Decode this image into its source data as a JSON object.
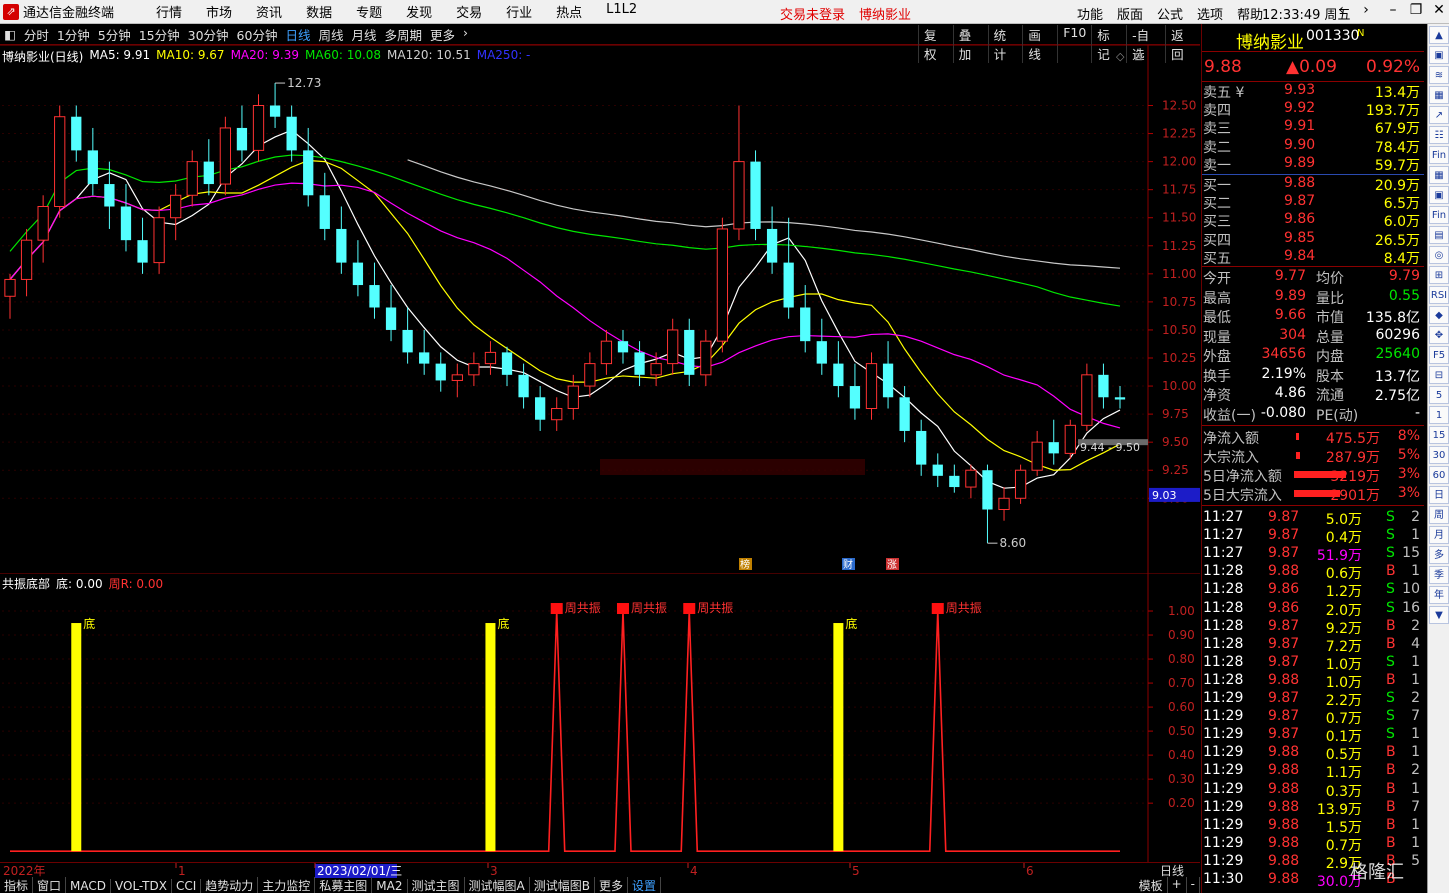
{
  "titlebar": {
    "app_title": "通达信金融终端",
    "menus": [
      "行情",
      "市场",
      "资讯",
      "数据",
      "专题",
      "发现",
      "交易",
      "行业",
      "热点",
      "L1L2"
    ],
    "login_status": "交易未登录",
    "stock_name": "博纳影业",
    "right_menus": [
      "功能",
      "版面",
      "公式",
      "选项",
      "帮助"
    ],
    "clock": "12:33:49",
    "weekday": "周五"
  },
  "periods": [
    "分时",
    "1分钟",
    "5分钟",
    "15分钟",
    "30分钟",
    "60分钟",
    "日线",
    "周线",
    "月线",
    "多周期",
    "更多"
  ],
  "active_period": "日线",
  "toolbuttons": [
    "复权",
    "叠加",
    "统计",
    "画线",
    "F10",
    "标记",
    "-自选",
    "返回"
  ],
  "main_info": {
    "title": "博纳影业(日线)",
    "ma5": "MA5: 9.91",
    "ma10": "MA10: 9.67",
    "ma20": "MA20: 9.39",
    "ma60": "MA60: 10.08",
    "ma120": "MA120: 10.51",
    "ma250": "MA250: -"
  },
  "sub_info": {
    "title": "共振底部",
    "bottom": "底: 0.00",
    "weekr": "周R: 0.00"
  },
  "chart_data": [
    {
      "type": "candlestick",
      "axis": "price",
      "yticks": [
        "12.50",
        "12.25",
        "12.00",
        "11.75",
        "11.50",
        "11.25",
        "11.00",
        "10.75",
        "10.50",
        "10.25",
        "10.00",
        "9.75",
        "9.50",
        "9.25",
        "9.00"
      ],
      "ylim": [
        8.45,
        12.95
      ],
      "annotations": {
        "high": "12.73",
        "low": "8.60",
        "last_label": "9.44 - 9.50",
        "current_price": "9.03",
        "markers": [
          "榜",
          "财",
          "涨"
        ]
      },
      "candles": [
        [
          10.8,
          11.0,
          10.6,
          10.95
        ],
        [
          10.95,
          11.4,
          10.8,
          11.3
        ],
        [
          11.3,
          11.7,
          11.1,
          11.6
        ],
        [
          11.6,
          12.5,
          11.5,
          12.4
        ],
        [
          12.4,
          12.5,
          12.0,
          12.1
        ],
        [
          12.1,
          12.3,
          11.7,
          11.8
        ],
        [
          11.8,
          12.0,
          11.4,
          11.6
        ],
        [
          11.6,
          11.8,
          11.2,
          11.3
        ],
        [
          11.3,
          11.5,
          11.0,
          11.1
        ],
        [
          11.1,
          11.6,
          11.0,
          11.5
        ],
        [
          11.5,
          11.8,
          11.3,
          11.7
        ],
        [
          11.7,
          12.1,
          11.6,
          12.0
        ],
        [
          12.0,
          12.2,
          11.7,
          11.8
        ],
        [
          11.8,
          12.4,
          11.7,
          12.3
        ],
        [
          12.3,
          12.5,
          12.0,
          12.1
        ],
        [
          12.1,
          12.6,
          12.0,
          12.5
        ],
        [
          12.5,
          12.7,
          12.3,
          12.4
        ],
        [
          12.4,
          12.5,
          12.0,
          12.1
        ],
        [
          12.1,
          12.3,
          11.6,
          11.7
        ],
        [
          11.7,
          11.9,
          11.3,
          11.4
        ],
        [
          11.4,
          11.6,
          11.0,
          11.1
        ],
        [
          11.1,
          11.3,
          10.8,
          10.9
        ],
        [
          10.9,
          11.1,
          10.6,
          10.7
        ],
        [
          10.7,
          10.9,
          10.4,
          10.5
        ],
        [
          10.5,
          10.7,
          10.2,
          10.3
        ],
        [
          10.3,
          10.5,
          10.1,
          10.2
        ],
        [
          10.2,
          10.3,
          9.95,
          10.05
        ],
        [
          10.05,
          10.2,
          9.9,
          10.1
        ],
        [
          10.1,
          10.3,
          10.0,
          10.2
        ],
        [
          10.2,
          10.4,
          10.1,
          10.3
        ],
        [
          10.3,
          10.35,
          10.0,
          10.1
        ],
        [
          10.1,
          10.2,
          9.8,
          9.9
        ],
        [
          9.9,
          10.0,
          9.6,
          9.7
        ],
        [
          9.7,
          9.9,
          9.6,
          9.8
        ],
        [
          9.8,
          10.1,
          9.7,
          10.0
        ],
        [
          10.0,
          10.3,
          9.9,
          10.2
        ],
        [
          10.2,
          10.5,
          10.1,
          10.4
        ],
        [
          10.4,
          10.5,
          10.2,
          10.3
        ],
        [
          10.3,
          10.4,
          10.0,
          10.1
        ],
        [
          10.1,
          10.3,
          10.0,
          10.2
        ],
        [
          10.2,
          10.6,
          10.1,
          10.5
        ],
        [
          10.5,
          10.6,
          10.0,
          10.1
        ],
        [
          10.1,
          10.5,
          10.0,
          10.4
        ],
        [
          10.4,
          11.5,
          10.3,
          11.4
        ],
        [
          11.4,
          12.5,
          11.3,
          12.0
        ],
        [
          12.0,
          12.1,
          11.3,
          11.4
        ],
        [
          11.4,
          11.6,
          11.0,
          11.1
        ],
        [
          11.1,
          11.5,
          10.6,
          10.7
        ],
        [
          10.7,
          10.9,
          10.3,
          10.4
        ],
        [
          10.4,
          10.6,
          10.1,
          10.2
        ],
        [
          10.2,
          10.4,
          9.9,
          10.0
        ],
        [
          10.0,
          10.2,
          9.7,
          9.8
        ],
        [
          9.8,
          10.3,
          9.7,
          10.2
        ],
        [
          10.2,
          10.4,
          9.8,
          9.9
        ],
        [
          9.9,
          10.0,
          9.5,
          9.6
        ],
        [
          9.6,
          9.7,
          9.2,
          9.3
        ],
        [
          9.3,
          9.4,
          9.1,
          9.2
        ],
        [
          9.2,
          9.3,
          9.05,
          9.1
        ],
        [
          9.1,
          9.3,
          9.0,
          9.25
        ],
        [
          9.25,
          9.3,
          8.6,
          8.9
        ],
        [
          8.9,
          9.1,
          8.8,
          9.0
        ],
        [
          9.0,
          9.3,
          8.95,
          9.25
        ],
        [
          9.25,
          9.6,
          9.2,
          9.5
        ],
        [
          9.5,
          9.7,
          9.3,
          9.4
        ],
        [
          9.4,
          9.7,
          9.35,
          9.65
        ],
        [
          9.65,
          10.2,
          9.6,
          10.1
        ],
        [
          10.1,
          10.2,
          9.8,
          9.9
        ],
        [
          9.9,
          10.0,
          9.8,
          9.88
        ]
      ]
    },
    {
      "type": "indicator",
      "axis": "value",
      "yticks": [
        "1.00",
        "0.90",
        "0.80",
        "0.70",
        "0.60",
        "0.50",
        "0.40",
        "0.30",
        "0.20"
      ],
      "ylim": [
        -0.02,
        1.1
      ],
      "bottom_bars": [
        {
          "index": 4,
          "label": "底"
        },
        {
          "index": 29,
          "label": "底"
        },
        {
          "index": 50,
          "label": "底"
        }
      ],
      "week_spikes": [
        {
          "index": 33,
          "label": "周共振"
        },
        {
          "index": 37,
          "label": "周共振"
        },
        {
          "index": 41,
          "label": "周共振"
        },
        {
          "index": 56,
          "label": "周共振"
        }
      ]
    }
  ],
  "dates": {
    "year": "2022年",
    "ticks": [
      "1",
      "2023/02/01/三",
      "3",
      "4",
      "5",
      "6"
    ],
    "period_label": "日线"
  },
  "bottom_tabs": [
    "指标",
    "窗口",
    "MACD",
    "VOL-TDX",
    "CCI",
    "趋势动力",
    "主力监控",
    "私募主图",
    "MA2",
    "测试主图",
    "测试幅图A",
    "测试幅图B",
    "更多",
    "设置"
  ],
  "bottom_right": [
    "模板",
    "+",
    "-"
  ],
  "quote": {
    "name": "博纳影业",
    "code": "001330",
    "badge": "N",
    "price": "9.88",
    "change": "▲0.09",
    "pct": "0.92%",
    "sells": [
      {
        "label": "卖五",
        "price": "9.93",
        "vol": "13.4万"
      },
      {
        "label": "卖四",
        "price": "9.92",
        "vol": "193.7万"
      },
      {
        "label": "卖三",
        "price": "9.91",
        "vol": "67.9万"
      },
      {
        "label": "卖二",
        "price": "9.90",
        "vol": "78.4万"
      },
      {
        "label": "卖一",
        "price": "9.89",
        "vol": "59.7万"
      }
    ],
    "buys": [
      {
        "label": "买一",
        "price": "9.88",
        "vol": "20.9万"
      },
      {
        "label": "买二",
        "price": "9.87",
        "vol": "6.5万"
      },
      {
        "label": "买三",
        "price": "9.86",
        "vol": "6.0万"
      },
      {
        "label": "买四",
        "price": "9.85",
        "vol": "26.5万"
      },
      {
        "label": "买五",
        "price": "9.84",
        "vol": "8.4万"
      }
    ],
    "stats": [
      [
        "今开",
        "9.77",
        "均价",
        "9.79"
      ],
      [
        "最高",
        "9.89",
        "量比",
        "0.55"
      ],
      [
        "最低",
        "9.66",
        "市值",
        "135.8亿"
      ],
      [
        "现量",
        "304",
        "总量",
        "60296"
      ],
      [
        "外盘",
        "34656",
        "内盘",
        "25640"
      ],
      [
        "换手",
        "2.19%",
        "股本",
        "13.7亿"
      ],
      [
        "净资",
        "4.86",
        "流通",
        "2.75亿"
      ],
      [
        "收益(一)",
        "-0.080",
        "PE(动)",
        "-"
      ]
    ],
    "flows": [
      [
        "净流入额",
        "475.5万",
        "8%"
      ],
      [
        "大宗流入",
        "287.9万",
        "5%"
      ],
      [
        "5日净流入额",
        "3219万",
        "3%"
      ],
      [
        "5日大宗流入",
        "2901万",
        "3%"
      ]
    ],
    "ticks": [
      [
        "11:27",
        "9.87",
        "5.0万",
        "S",
        "2"
      ],
      [
        "11:27",
        "9.87",
        "0.4万",
        "S",
        "1"
      ],
      [
        "11:27",
        "9.87",
        "51.9万",
        "S",
        "15"
      ],
      [
        "11:28",
        "9.88",
        "0.6万",
        "B",
        "1"
      ],
      [
        "11:28",
        "9.86",
        "1.2万",
        "S",
        "10"
      ],
      [
        "11:28",
        "9.86",
        "2.0万",
        "S",
        "16"
      ],
      [
        "11:28",
        "9.87",
        "9.2万",
        "B",
        "2"
      ],
      [
        "11:28",
        "9.87",
        "7.2万",
        "B",
        "4"
      ],
      [
        "11:28",
        "9.87",
        "1.0万",
        "S",
        "1"
      ],
      [
        "11:28",
        "9.88",
        "1.0万",
        "B",
        "1"
      ],
      [
        "11:29",
        "9.87",
        "2.2万",
        "S",
        "2"
      ],
      [
        "11:29",
        "9.87",
        "0.7万",
        "S",
        "7"
      ],
      [
        "11:29",
        "9.87",
        "0.1万",
        "S",
        "1"
      ],
      [
        "11:29",
        "9.88",
        "0.5万",
        "B",
        "1"
      ],
      [
        "11:29",
        "9.88",
        "1.1万",
        "B",
        "2"
      ],
      [
        "11:29",
        "9.88",
        "0.3万",
        "B",
        "1"
      ],
      [
        "11:29",
        "9.88",
        "13.9万",
        "B",
        "7"
      ],
      [
        "11:29",
        "9.88",
        "1.5万",
        "B",
        "1"
      ],
      [
        "11:29",
        "9.88",
        "0.7万",
        "B",
        "1"
      ],
      [
        "11:29",
        "9.88",
        "2.9万",
        "B",
        "5"
      ],
      [
        "11:30",
        "9.88",
        "30.0万",
        "B",
        ""
      ]
    ]
  },
  "sidebar": [
    "▲",
    "▣",
    "≋",
    "▦",
    "↗",
    "☷",
    "Fin",
    "▦",
    "▣",
    "Fin",
    "▤",
    "◎",
    "⊞",
    "RSI",
    "◆",
    "✥",
    "F5",
    "⊟",
    "5",
    "1",
    "15",
    "30",
    "60",
    "日",
    "周",
    "月",
    "多",
    "季",
    "年",
    "▼"
  ],
  "watermark": "格隆汇"
}
